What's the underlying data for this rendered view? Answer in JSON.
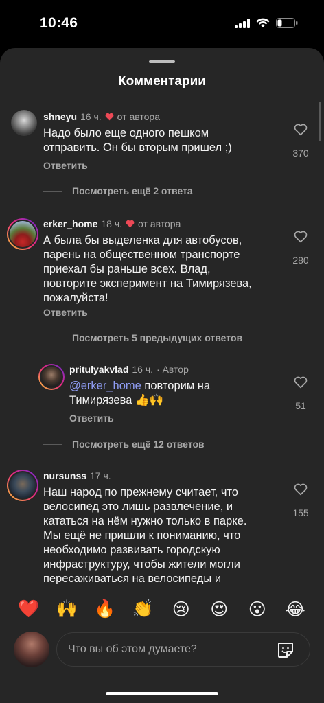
{
  "status_bar": {
    "time": "10:46"
  },
  "sheet": {
    "title": "Комментарии"
  },
  "comments": [
    {
      "username": "shneyu",
      "time": "16 ч.",
      "badge": "от автора",
      "text": "Надо было еще одного пешком отправить. Он бы вторым пришел ;)",
      "reply_label": "Ответить",
      "likes": "370",
      "more_label": "Посмотреть ещё 2 ответа"
    },
    {
      "username": "erker_home",
      "time": "18 ч.",
      "badge": "от автора",
      "text": "А была бы выделенка для автобусов, парень на общественном транспорте приехал бы раньше всех. Влад, повторите эксперимент на Тимирязева, пожалуйста!",
      "reply_label": "Ответить",
      "likes": "280",
      "more_label": "Посмотреть 5 предыдущих ответов"
    },
    {
      "username": "pritulyakvlad",
      "time": "16 ч.",
      "badge": "· Автор",
      "mention": "@erker_home",
      "text": " повторим на Тимирязева 👍🙌",
      "reply_label": "Ответить",
      "likes": "51",
      "more_label": "Посмотреть ещё 12 ответов"
    },
    {
      "username": "nursunss",
      "time": "17 ч.",
      "text": "Наш народ по прежнему считает, что велосипед это лишь развлечение, и кататься на нём нужно только в парке. Мы ещё не пришли к пониманию, что необходимо развивать городскую инфраструктуру, чтобы жители могли пересаживаться на велосипеды и самокаты. Вместо этого власти могут",
      "likes": "155"
    }
  ],
  "emoji_bar": [
    "❤️",
    "🙌",
    "🔥",
    "👏",
    "😢",
    "😍",
    "😮",
    "😂"
  ],
  "composer": {
    "placeholder": "Что вы об этом думаете?"
  },
  "colors": {
    "background": "#262626",
    "heart_red": "#ed4956",
    "mention": "#8f9cf2"
  }
}
